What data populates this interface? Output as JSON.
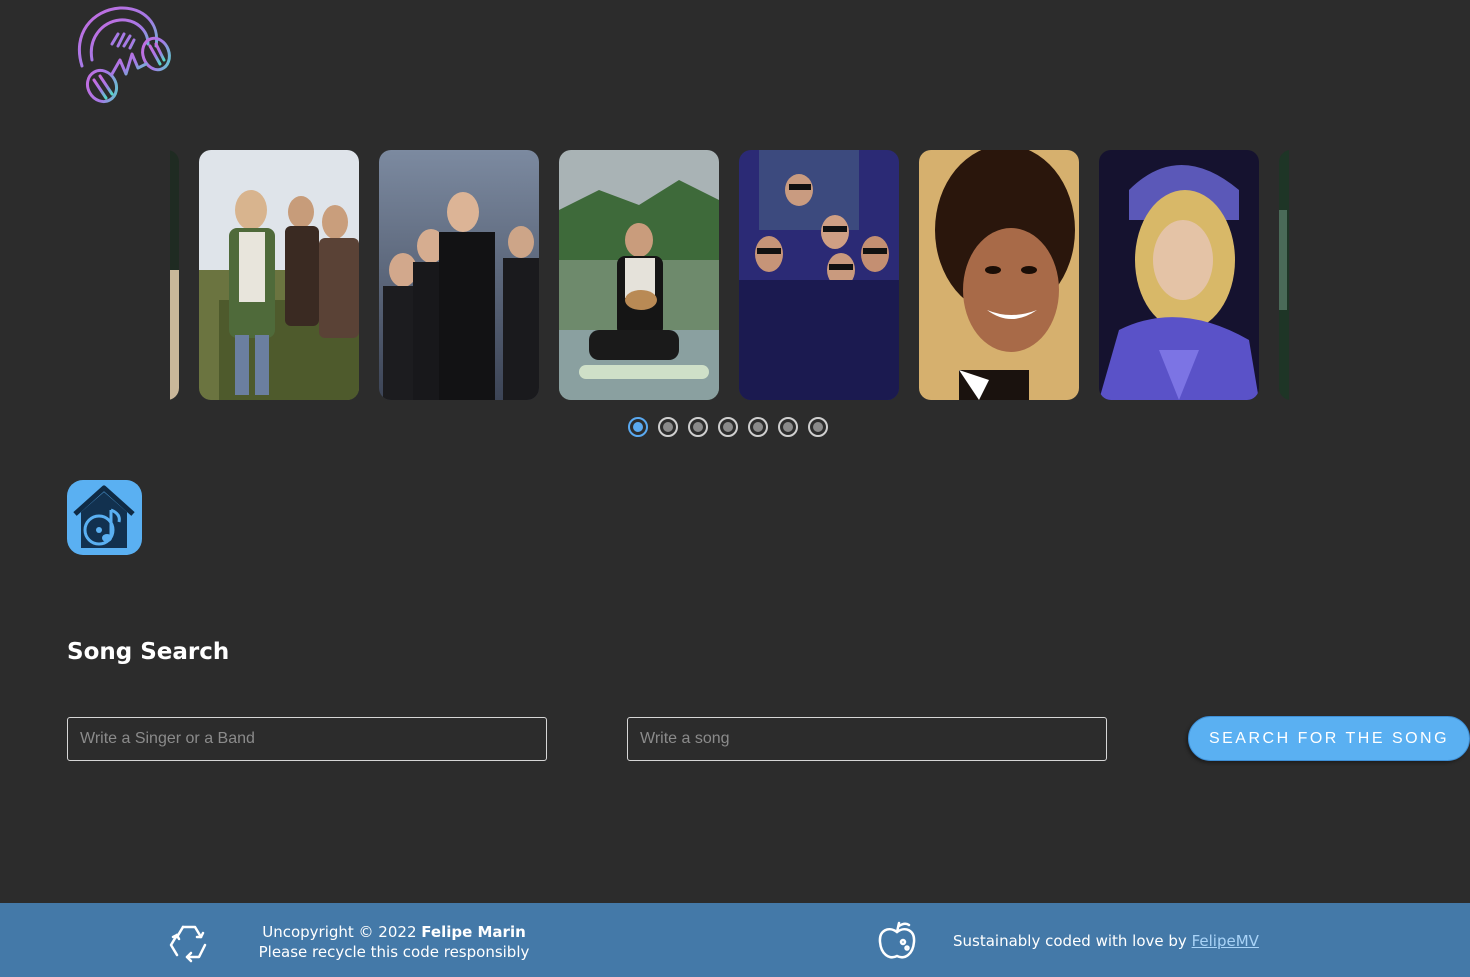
{
  "brand": {
    "logo_icon": "headphones-logo-icon"
  },
  "carousel": {
    "slides": [
      {
        "name": "slide-partial-left",
        "colors": [
          "#2b3a2e",
          "#c9b79a"
        ]
      },
      {
        "name": "slide-nirvana",
        "colors": [
          "#d9e0e8",
          "#5e6b3c"
        ]
      },
      {
        "name": "slide-coldplay",
        "colors": [
          "#6f7f96",
          "#1a1a1c"
        ]
      },
      {
        "name": "slide-eddie-vedder",
        "colors": [
          "#3e6a3a",
          "#7f9aa5"
        ]
      },
      {
        "name": "slide-metallica",
        "colors": [
          "#2d2a6e",
          "#1a1a3c"
        ]
      },
      {
        "name": "slide-michael-jackson",
        "colors": [
          "#d6b178",
          "#3a1f12"
        ]
      },
      {
        "name": "slide-madonna",
        "colors": [
          "#1c1845",
          "#6a5fd0"
        ]
      },
      {
        "name": "slide-partial-right",
        "colors": [
          "#1e3a2a",
          "#4a6a58"
        ]
      }
    ],
    "dots_count": 7,
    "active_dot": 1
  },
  "home": {
    "icon": "home-music-icon"
  },
  "search": {
    "title": "Song Search",
    "singer_placeholder": "Write a Singer or a Band",
    "song_placeholder": "Write a song",
    "button_label": "Search for the song"
  },
  "footer": {
    "copyright_prefix": "Uncopyright © 2022",
    "author": "Felipe Marin",
    "recycle_note": "Please recycle this code responsibly",
    "credit_text": "Sustainably coded with love by",
    "credit_link": "FelipeMV",
    "icons": [
      "recycle-icon",
      "apple-icon"
    ]
  },
  "colors": {
    "background": "#2c2c2c",
    "accent": "#5ab0f2",
    "footer": "#4479a8"
  }
}
